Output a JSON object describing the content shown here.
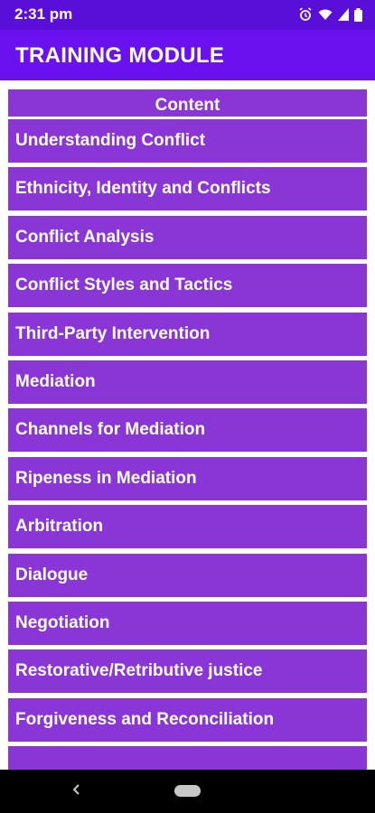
{
  "status_bar": {
    "time": "2:31 pm",
    "icons": [
      "alarm-icon",
      "wifi-icon",
      "signal-icon",
      "battery-icon"
    ]
  },
  "app_bar": {
    "title": "TRAINING MODULE"
  },
  "list": {
    "header": "Content",
    "items": [
      "Understanding Conflict",
      "Ethnicity, Identity and Conflicts",
      "Conflict Analysis",
      "Conflict Styles and Tactics",
      "Third-Party Intervention",
      "Mediation",
      "Channels for Mediation",
      "Ripeness in Mediation",
      "Arbitration",
      "Dialogue",
      "Negotiation",
      "Restorative/Retributive justice",
      "Forgiveness and Reconciliation",
      ""
    ]
  },
  "nav_bar": {
    "icons": [
      "back-icon",
      "home-pill-icon"
    ]
  },
  "colors": {
    "status_bar": "#5a0fd8",
    "app_bar": "#6b11f0",
    "item_bg": "#8a36d6",
    "text": "#ffffff"
  }
}
